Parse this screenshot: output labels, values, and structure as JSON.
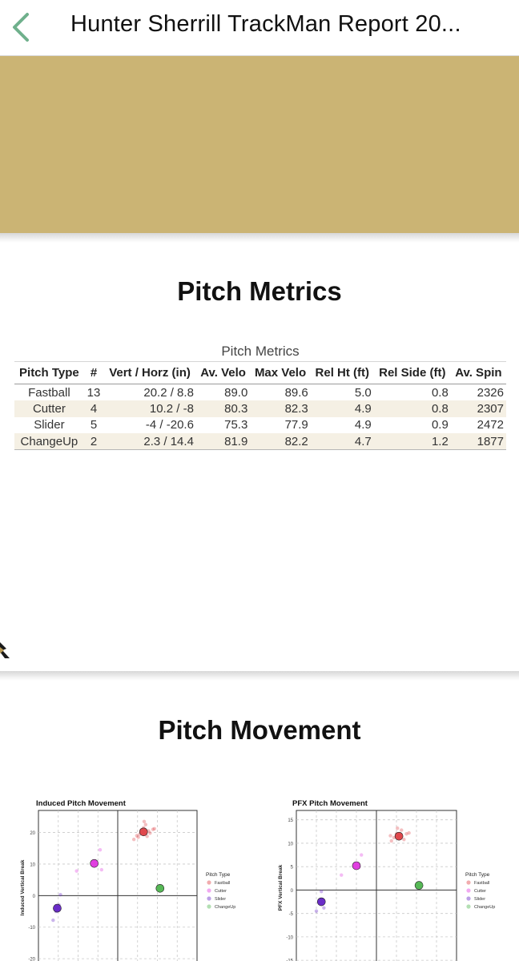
{
  "nav": {
    "title": "Hunter  Sherrill TrackMan Report 20..."
  },
  "colors": {
    "banner": "#cbb474",
    "back_arrow": "#6fb08c",
    "fastball": "#e0474c",
    "cutter": "#e040e0",
    "slider": "#6a2cc8",
    "changeup": "#56b856"
  },
  "sections": {
    "metrics_title": "Pitch Metrics",
    "movement_title": "Pitch Movement"
  },
  "metrics_table": {
    "caption": "Pitch Metrics",
    "headers": [
      "Pitch Type",
      "#",
      "Vert / Horz (in)",
      "Av. Velo",
      "Max Velo",
      "Rel Ht (ft)",
      "Rel Side (ft)",
      "Av. Spin"
    ],
    "rows": [
      [
        "Fastball",
        "13",
        "20.2 / 8.8",
        "89.0",
        "89.6",
        "5.0",
        "0.8",
        "2326"
      ],
      [
        "Cutter",
        "4",
        "10.2 / -8",
        "80.3",
        "82.3",
        "4.9",
        "0.8",
        "2307"
      ],
      [
        "Slider",
        "5",
        "-4 / -20.6",
        "75.3",
        "77.9",
        "4.9",
        "0.9",
        "2472"
      ],
      [
        "ChangeUp",
        "2",
        "2.3 / 14.4",
        "81.9",
        "82.2",
        "4.7",
        "1.2",
        "1877"
      ]
    ]
  },
  "chart_data": [
    {
      "type": "scatter",
      "title": "Induced Pitch Movement",
      "xlabel": "",
      "ylabel": "Induced Vertical Break",
      "ylim": [
        -22,
        27
      ],
      "xlim": [
        -27,
        27
      ],
      "yticks": [
        20,
        10,
        0,
        -10,
        -20
      ],
      "tick_labels": [
        "20",
        "10",
        "0",
        "-10",
        "-20"
      ],
      "grid": true,
      "legend_title": "Pitch Type",
      "legend": [
        "Fastball",
        "Cutter",
        "Slider",
        "ChangeUp"
      ],
      "legend_position": "right",
      "series": [
        {
          "name": "Fastball",
          "mean": [
            8.8,
            20.2
          ],
          "points": [
            [
              5.5,
              17.8
            ],
            [
              7.5,
              19.5
            ],
            [
              8.8,
              21.5
            ],
            [
              10.5,
              20.5
            ],
            [
              12,
              21
            ],
            [
              9.5,
              22.5
            ],
            [
              7,
              18.5
            ],
            [
              11,
              19.8
            ],
            [
              9,
              23.5
            ],
            [
              6.5,
              19
            ],
            [
              10,
              18.8
            ],
            [
              8,
              20.8
            ],
            [
              12.5,
              21.2
            ]
          ]
        },
        {
          "name": "Cutter",
          "mean": [
            -8,
            10.2
          ],
          "points": [
            [
              -14,
              7.8
            ],
            [
              -5.5,
              8.2
            ],
            [
              -6,
              14.5
            ],
            [
              -8,
              10.5
            ]
          ]
        },
        {
          "name": "Slider",
          "mean": [
            -20.6,
            -4
          ],
          "points": [
            [
              -22,
              -7.8
            ],
            [
              -19.5,
              0.3
            ],
            [
              -21,
              -5
            ],
            [
              -20,
              -3
            ],
            [
              -20.5,
              -4.2
            ]
          ]
        },
        {
          "name": "ChangeUp",
          "mean": [
            14.4,
            2.3
          ],
          "points": [
            [
              14.4,
              2.3
            ]
          ]
        }
      ]
    },
    {
      "type": "scatter",
      "title": "PFX Pitch Movement",
      "xlabel": "",
      "ylabel": "PFX Vertical Break",
      "ylim": [
        -16,
        17
      ],
      "xlim": [
        -16,
        16
      ],
      "yticks": [
        15,
        10,
        5,
        0,
        -5,
        -10,
        -15
      ],
      "tick_labels": [
        "15",
        "10",
        "5",
        "0",
        "-5",
        "-10",
        "-15"
      ],
      "grid": true,
      "legend_title": "Pitch Type",
      "legend": [
        "Fastball",
        "Cutter",
        "Slider",
        "ChangeUp"
      ],
      "legend_position": "right",
      "series": [
        {
          "name": "Fastball",
          "mean": [
            4.5,
            11.5
          ],
          "points": [
            [
              3,
              10.5
            ],
            [
              4,
              12
            ],
            [
              5,
              12.8
            ],
            [
              6,
              12
            ],
            [
              3.5,
              11.2
            ],
            [
              5.5,
              10.8
            ],
            [
              4.2,
              13.2
            ],
            [
              6.5,
              12.2
            ],
            [
              2.8,
              11.6
            ]
          ]
        },
        {
          "name": "Cutter",
          "mean": [
            -4,
            5.2
          ],
          "points": [
            [
              -7,
              3.2
            ],
            [
              -3,
              7.5
            ],
            [
              -3.5,
              4.8
            ]
          ]
        },
        {
          "name": "Slider",
          "mean": [
            -11,
            -2.5
          ],
          "points": [
            [
              -12,
              -4.5
            ],
            [
              -11,
              -0.3
            ],
            [
              -10.5,
              -3.8
            ]
          ]
        },
        {
          "name": "ChangeUp",
          "mean": [
            8.5,
            1
          ],
          "points": [
            [
              8.5,
              1
            ]
          ]
        }
      ]
    }
  ]
}
